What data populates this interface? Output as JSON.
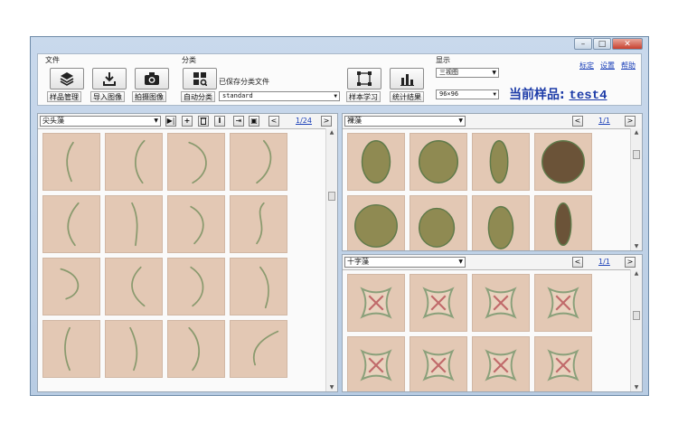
{
  "window": {
    "controls": {
      "minimize": "–",
      "restore": "□",
      "close": "✕"
    }
  },
  "ribbon": {
    "file_group": "文件",
    "classify_group": "分类",
    "display_group": "显示",
    "buttons": {
      "sample_manage": "样品管理",
      "import_image": "导入图像",
      "capture_image": "拍摄图像",
      "auto_classify": "自动分类",
      "sample_learning": "样本学习",
      "statistics": "统计结果"
    },
    "saved_file_label": "已保存分类文件",
    "classify_file_value": "standard",
    "view_mode_value": "三视图",
    "thumb_size_value": "96×96",
    "links": [
      "标定",
      "设置",
      "帮助"
    ],
    "current_sample_label": "当前样品:",
    "current_sample_value": "test4"
  },
  "left_pane": {
    "category": "尖头藻",
    "page": "1/24",
    "prev": "<",
    "next": ">"
  },
  "right_top_pane": {
    "category": "裸藻",
    "page": "1/1",
    "prev": "<",
    "next": ">"
  },
  "right_bottom_pane": {
    "category": "十字藻",
    "page": "1/1",
    "prev": "<",
    "next": ">"
  },
  "toolbar_glyphs": {
    "play_end": "▶|",
    "add": "+",
    "delete": "🗑",
    "rename": "I",
    "export": "⇥",
    "save": "▣"
  },
  "colors": {
    "accent_text": "#1d3ca8",
    "cell_bg": "#e3c8b4",
    "window_frame": "#b8cce3"
  }
}
